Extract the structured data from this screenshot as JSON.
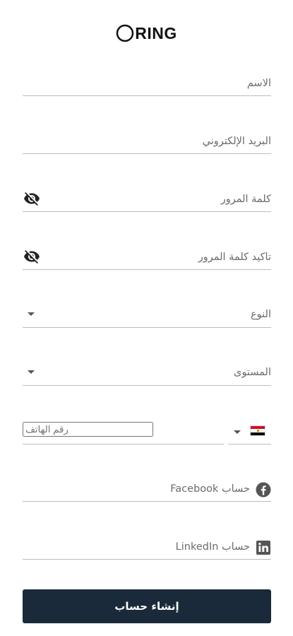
{
  "brand": {
    "logo_text": "RING"
  },
  "form": {
    "name": {
      "placeholder": "الاسم",
      "value": ""
    },
    "email": {
      "placeholder": "البريد الإلكتروني",
      "value": ""
    },
    "password": {
      "placeholder": "كلمة المرور",
      "value": "",
      "toggle_icon": "eye-off-icon"
    },
    "confirm_password": {
      "placeholder": "تأكيد كلمة المرور",
      "value": "",
      "toggle_icon": "eye-off-icon"
    },
    "gender": {
      "label": "النوع",
      "selected": ""
    },
    "level": {
      "label": "المستوى",
      "selected": ""
    },
    "phone": {
      "placeholder": "رقم الهاتف",
      "value": "",
      "country_flag": "egypt-flag-icon"
    },
    "facebook": {
      "placeholder": "حساب Facebook",
      "value": "",
      "icon": "facebook-icon"
    },
    "linkedin": {
      "placeholder": "حساب LinkedIn",
      "value": "",
      "icon": "linkedin-icon"
    },
    "submit_label": "إنشاء حساب"
  },
  "colors": {
    "primary_button": "#1a2a3a",
    "underline": "#bcbcbc",
    "text_muted": "#6b6b6b"
  }
}
